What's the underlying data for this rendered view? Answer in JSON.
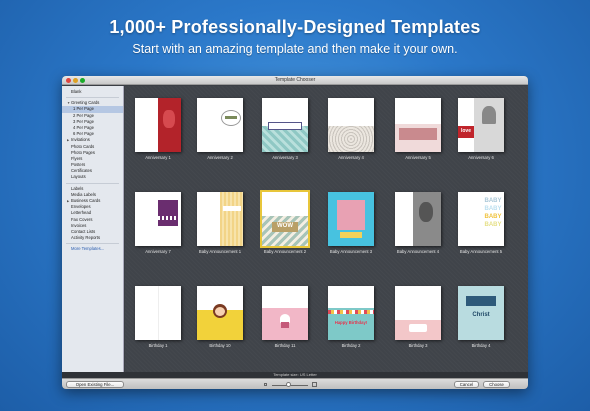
{
  "hero": {
    "title": "1,000+ Professionally-Designed Templates",
    "subtitle": "Start with an amazing template and then make it your own."
  },
  "window": {
    "title": "Template Chooser",
    "status": "Template size: US Letter",
    "open_button": "Open Existing File...",
    "cancel_button": "Cancel",
    "choose_button": "Choose"
  },
  "sidebar": {
    "items": [
      {
        "label": "Blank",
        "level": 0
      },
      {
        "label": "Greeting Cards",
        "level": 0,
        "disclosure": "open"
      },
      {
        "label": "1 Per Page",
        "level": 1,
        "selected": true
      },
      {
        "label": "2 Per Page",
        "level": 1
      },
      {
        "label": "3 Per Page",
        "level": 1
      },
      {
        "label": "4 Per Page",
        "level": 1
      },
      {
        "label": "6 Per Page",
        "level": 1
      },
      {
        "label": "Invitations",
        "level": 0,
        "disclosure": "closed"
      },
      {
        "label": "Photo Cards",
        "level": 0
      },
      {
        "label": "Photo Pages",
        "level": 0
      },
      {
        "label": "Flyers",
        "level": 0
      },
      {
        "label": "Posters",
        "level": 0
      },
      {
        "label": "Certificates",
        "level": 0
      },
      {
        "label": "Layouts",
        "level": 0
      },
      {
        "label": "Labels",
        "level": 0
      },
      {
        "label": "Media Labels",
        "level": 0
      },
      {
        "label": "Business Cards",
        "level": 0,
        "disclosure": "closed"
      },
      {
        "label": "Envelopes",
        "level": 0
      },
      {
        "label": "Letterhead",
        "level": 0
      },
      {
        "label": "Fax Covers",
        "level": 0
      },
      {
        "label": "Invoices",
        "level": 0
      },
      {
        "label": "Contact Lists",
        "level": 0
      },
      {
        "label": "Activity Reports",
        "level": 0
      },
      {
        "label": "More Templates...",
        "level": 0,
        "link": true
      }
    ]
  },
  "templates": [
    {
      "label": "Anniversary 1",
      "art": "red-panel"
    },
    {
      "label": "Anniversary 2",
      "art": "script-love"
    },
    {
      "label": "Anniversary 3",
      "art": "teal-banner"
    },
    {
      "label": "Anniversary 4",
      "art": "lace"
    },
    {
      "label": "Anniversary 5",
      "art": "pink-strip"
    },
    {
      "label": "Anniversary 6",
      "art": "love-photo",
      "text": "love"
    },
    {
      "label": "Anniversary 7",
      "art": "purple-wave"
    },
    {
      "label": "Baby Announcement 1",
      "art": "yellow-stripe"
    },
    {
      "label": "Baby Announcement 2",
      "art": "chevron-wow",
      "text": "WOW",
      "selected": true
    },
    {
      "label": "Baby Announcement 3",
      "art": "cyan-photo"
    },
    {
      "label": "Baby Announcement 4",
      "art": "gray-photo"
    },
    {
      "label": "Baby Announcement 5",
      "art": "baby-letters",
      "text": "BABY"
    },
    {
      "label": "Birthday 1",
      "art": "plain"
    },
    {
      "label": "Birthday 10",
      "art": "yellow-face"
    },
    {
      "label": "Birthday 11",
      "art": "pink-cupcake"
    },
    {
      "label": "Birthday 2",
      "art": "bunting-bday",
      "text": "Happy Birthday!"
    },
    {
      "label": "Birthday 3",
      "art": "pink-bottom"
    },
    {
      "label": "Birthday 4",
      "art": "xmas",
      "text": "Christ"
    }
  ],
  "colors": {
    "background": "#2b78c9",
    "selection": "#e8c63a",
    "sidebar_selected": "#b5c7e3",
    "love_red": "#c0242b"
  }
}
